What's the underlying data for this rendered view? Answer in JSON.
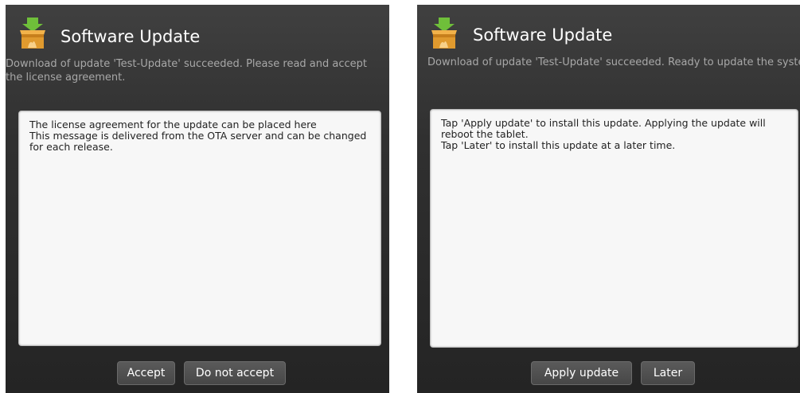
{
  "left_dialog": {
    "title": "Software Update",
    "message": "Download of update 'Test-Update' succeeded. Please read and accept the license agreement.",
    "content_lines": [
      "The license agreement for the update can be placed here",
      "This message is delivered from the OTA server and can be changed for each release."
    ],
    "buttons": {
      "accept": "Accept",
      "reject": "Do not accept"
    }
  },
  "right_dialog": {
    "title": "Software Update",
    "message": "Download of update 'Test-Update' succeeded. Ready to update the system.",
    "content_lines": [
      "Tap 'Apply update' to install this update. Applying the update will reboot the tablet.",
      "Tap 'Later' to install this update at a later time."
    ],
    "buttons": {
      "apply": "Apply update",
      "later": "Later"
    }
  },
  "icon": "package-download-icon",
  "colors": {
    "dialog_background": "#2e2e2e",
    "title": "#ffffff",
    "message": "#a8a8a8",
    "content_background": "#f7f7f7"
  }
}
